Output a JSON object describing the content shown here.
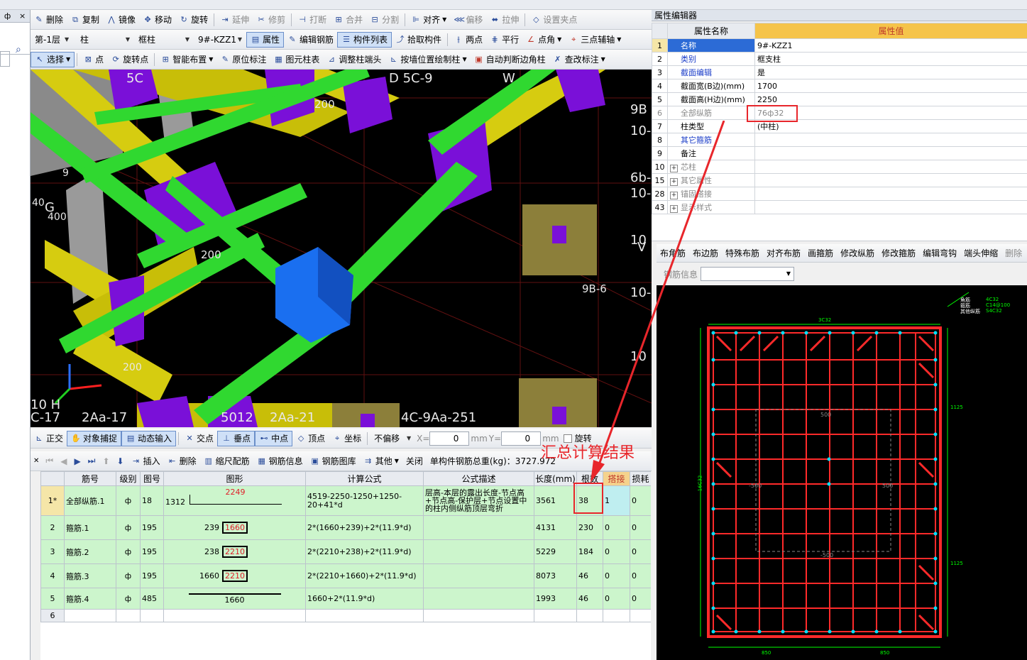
{
  "top_toolbar": {
    "items": [
      "删除",
      "复制",
      "镜像",
      "移动",
      "旋转",
      "延伸",
      "修剪",
      "打断",
      "合并",
      "分割",
      "对齐",
      "偏移",
      "拉伸",
      "设置夹点"
    ]
  },
  "floor_bar": {
    "floor": "第-1层",
    "type": "柱",
    "subtype": "框柱",
    "component": "9#-KZZ1",
    "buttons": [
      "属性",
      "编辑钢筋",
      "构件列表",
      "拾取构件",
      "两点",
      "平行",
      "点角",
      "三点辅轴"
    ]
  },
  "draw_bar": {
    "items": [
      "选择",
      "点",
      "旋转点",
      "智能布置",
      "原位标注",
      "图元柱表",
      "调整柱端头",
      "按墙位置绘制柱",
      "自动判断边角柱",
      "查改标注"
    ]
  },
  "left_panel": {
    "pin": "ф",
    "close": "×",
    "search_icon": "⌕"
  },
  "viewport": {
    "labels": [
      "5C",
      "D 5C-9",
      "W",
      "200",
      "9B",
      "10-",
      "6b-",
      "10-",
      "10",
      "V",
      "9B-6",
      "10-",
      "10",
      "200",
      "200",
      "G",
      "400",
      "40",
      "9",
      "10 H",
      "C-17",
      "2Aa-17",
      "5012",
      "2Aa-21",
      "4C-9Aa-251",
      "2Aa",
      "200"
    ]
  },
  "snap_bar": {
    "items": [
      "正交",
      "对象捕捉",
      "动态输入",
      "交点",
      "垂点",
      "中点",
      "顶点",
      "坐标",
      "不偏移"
    ],
    "x_label": "X=",
    "x_value": "0",
    "unit1": "mm",
    "y_label": "Y=",
    "y_value": "0",
    "unit2": "mm",
    "rotate": "旋转"
  },
  "grid_toolbar": {
    "items": [
      "插入",
      "删除",
      "缩尺配筋",
      "钢筋信息",
      "钢筋图库",
      "其他",
      "关闭"
    ],
    "total": "单构件钢筋总重(kg)：3727.972"
  },
  "grid": {
    "headers": [
      "筋号",
      "级别",
      "图号",
      "图形",
      "计算公式",
      "公式描述",
      "长度(mm)",
      "根数",
      "搭接",
      "损耗"
    ],
    "rows": [
      {
        "num": "1*",
        "name": "全部纵筋.1",
        "grade": "ф",
        "fig": "18",
        "shape_left": "1312",
        "shape_val": "2249",
        "formula": "4519-2250-1250+1250-20+41*d",
        "desc": "层高-本层的露出长度-节点高+节点高-保护层+节点设置中的柱内侧纵筋顶层弯折",
        "length": "3561",
        "count": "38",
        "lap": "1",
        "loss": "0"
      },
      {
        "num": "2",
        "name": "箍筋.1",
        "grade": "ф",
        "fig": "195",
        "shape_left": "239",
        "shape_val": "1660",
        "formula": "2*(1660+239)+2*(11.9*d)",
        "desc": "",
        "length": "4131",
        "count": "230",
        "lap": "0",
        "loss": "0"
      },
      {
        "num": "3",
        "name": "箍筋.2",
        "grade": "ф",
        "fig": "195",
        "shape_left": "238",
        "shape_val": "2210",
        "formula": "2*(2210+238)+2*(11.9*d)",
        "desc": "",
        "length": "5229",
        "count": "184",
        "lap": "0",
        "loss": "0"
      },
      {
        "num": "4",
        "name": "箍筋.3",
        "grade": "ф",
        "fig": "195",
        "shape_left": "1660",
        "shape_val": "2210",
        "formula": "2*(2210+1660)+2*(11.9*d)",
        "desc": "",
        "length": "8073",
        "count": "46",
        "lap": "0",
        "loss": "0"
      },
      {
        "num": "5",
        "name": "箍筋.4",
        "grade": "ф",
        "fig": "485",
        "shape_left": "",
        "shape_val": "1660",
        "formula": "1660+2*(11.9*d)",
        "desc": "",
        "length": "1993",
        "count": "46",
        "lap": "0",
        "loss": "0"
      },
      {
        "num": "6",
        "name": "",
        "grade": "",
        "fig": "",
        "shape_left": "",
        "shape_val": "",
        "formula": "",
        "desc": "",
        "length": "",
        "count": "",
        "lap": "",
        "loss": ""
      }
    ]
  },
  "annotation": {
    "text": "汇总计算结果"
  },
  "property_editor": {
    "title": "属性编辑器",
    "col_name": "属性名称",
    "col_value": "属性值",
    "rows": [
      {
        "id": "1",
        "name": "名称",
        "value": "9#-KZZ1",
        "link": true
      },
      {
        "id": "2",
        "name": "类别",
        "value": "框支柱",
        "link": true
      },
      {
        "id": "3",
        "name": "截面编辑",
        "value": "是",
        "link": true
      },
      {
        "id": "4",
        "name": "截面宽(B边)(mm)",
        "value": "1700",
        "link": false
      },
      {
        "id": "5",
        "name": "截面高(H边)(mm)",
        "value": "2250",
        "link": false
      },
      {
        "id": "6",
        "name": "全部纵筋",
        "value": "76ф32",
        "link": false,
        "grey": true
      },
      {
        "id": "7",
        "name": "柱类型",
        "value": "(中柱)",
        "link": false
      },
      {
        "id": "8",
        "name": "其它箍筋",
        "value": "",
        "link": true
      },
      {
        "id": "9",
        "name": "备注",
        "value": "",
        "link": false
      },
      {
        "id": "10",
        "name": "芯柱",
        "value": "",
        "link": false,
        "expand": true,
        "grey": true
      },
      {
        "id": "15",
        "name": "其它属性",
        "value": "",
        "link": false,
        "expand": true,
        "grey": true
      },
      {
        "id": "28",
        "name": "锚固搭接",
        "value": "",
        "link": false,
        "expand": true,
        "grey": true
      },
      {
        "id": "43",
        "name": "显示样式",
        "value": "",
        "link": false,
        "expand": true,
        "grey": true
      }
    ]
  },
  "rebar_toolbar": {
    "items": [
      "布角筋",
      "布边筋",
      "特殊布筋",
      "对齐布筋",
      "画箍筋",
      "修改纵筋",
      "修改箍筋",
      "编辑弯钩",
      "端头伸缩",
      "删除"
    ],
    "info_label": "钢筋信息"
  },
  "section_preview": {
    "legend": [
      "角筋",
      "箍筋",
      "其他纵筋"
    ],
    "legend_values": [
      "4C32",
      "C14@100",
      "S4C32"
    ],
    "top_label": "3C32",
    "dim_right": [
      "1125",
      "1125"
    ],
    "dim_left": "16C32",
    "dim_bottom": [
      "850",
      "850"
    ],
    "inner": [
      "500",
      "-500",
      "-500",
      "500",
      "-500"
    ],
    "colors": {
      "frame": "#ff2a2a",
      "dim": "#00ff00"
    }
  }
}
